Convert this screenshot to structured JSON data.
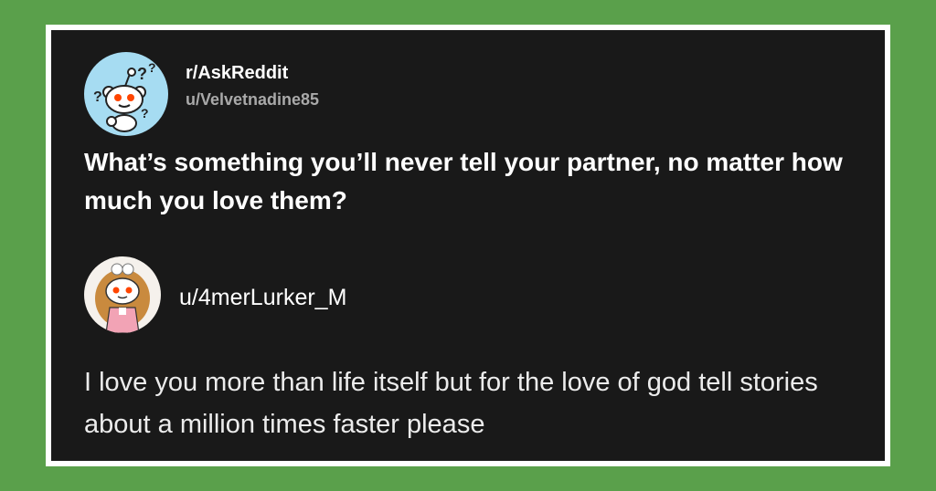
{
  "post": {
    "subreddit": "r/AskReddit",
    "author": "u/Velvetnadine85",
    "title": "What’s something you’ll never tell your partner, no matter how much you love them?"
  },
  "comment": {
    "author": "u/4merLurker_M",
    "text": "I love you more than life itself but for the love of god tell stories about a million times faster please"
  },
  "icons": {
    "subreddit_avatar": "reddit-snoo-question-icon",
    "commenter_avatar": "reddit-snoo-girl-icon"
  },
  "colors": {
    "background": "#5aa04b",
    "card": "#191919",
    "frame": "#ffffff",
    "muted_text": "#a9a9a9"
  }
}
